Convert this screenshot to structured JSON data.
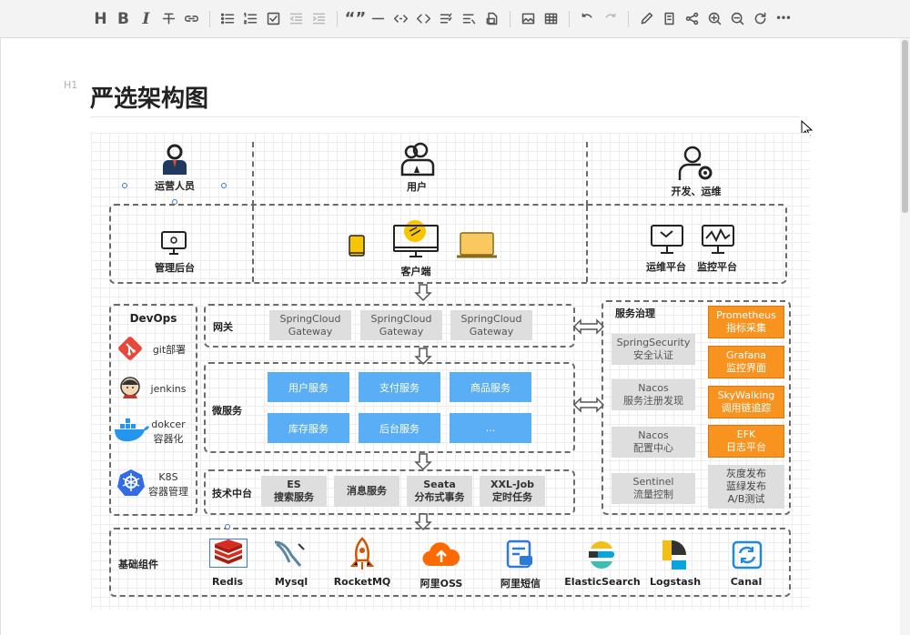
{
  "toolbar": {
    "buttons": [
      "heading",
      "bold",
      "italic",
      "strikethrough",
      "link",
      "bulleted-list",
      "numbered-list",
      "task-list",
      "outdent",
      "indent",
      "quote",
      "horizontal-rule",
      "inline-code",
      "code-block",
      "table-of-contents",
      "outline",
      "export",
      "image",
      "table",
      "undo",
      "redo",
      "edit",
      "notes",
      "share",
      "zoom-in",
      "zoom-out",
      "refresh",
      "more"
    ],
    "heading_glyph": "H",
    "bold_glyph": "B",
    "italic_glyph": "I",
    "quote_glyph": "“”",
    "more_glyph": "•••"
  },
  "document": {
    "heading_tag": "H1",
    "title": "严选架构图"
  },
  "diagram": {
    "actors": {
      "ops": "运营人员",
      "user": "用户",
      "dev": "开发、运维"
    },
    "admin": "管理后台",
    "client": "客户端",
    "ops_platform": "运维平台",
    "monitor_platform": "监控平台",
    "devops": {
      "title": "DevOps",
      "items": [
        {
          "label1": "git部署",
          "label2": ""
        },
        {
          "label1": "jenkins",
          "label2": ""
        },
        {
          "label1": "dokcer",
          "label2": "容器化"
        },
        {
          "label1": "K8S",
          "label2": "容器管理"
        }
      ]
    },
    "gateway": {
      "label": "网关",
      "items": [
        [
          "SpringCloud",
          "Gateway"
        ],
        [
          "SpringCloud",
          "Gateway"
        ],
        [
          "SpringCloud",
          "Gateway"
        ]
      ]
    },
    "microservice": {
      "label": "微服务",
      "items": [
        "用户服务",
        "支付服务",
        "商品服务",
        "库存服务",
        "后台服务",
        "..."
      ]
    },
    "tech": {
      "label": "技术中台",
      "items": [
        [
          "ES",
          "搜索服务"
        ],
        [
          "消息服务",
          ""
        ],
        [
          "Seata",
          "分布式事务"
        ],
        [
          "XXL-Job",
          "定时任务"
        ]
      ]
    },
    "governance": {
      "title": "服务治理",
      "gray": [
        [
          "SpringSecurity",
          "安全认证"
        ],
        [
          "Nacos",
          "服务注册发现"
        ],
        [
          "Nacos",
          "配置中心"
        ],
        [
          "Sentinel",
          "流量控制"
        ]
      ],
      "orange": [
        [
          "Prometheus",
          "指标采集"
        ],
        [
          "Grafana",
          "监控界面"
        ],
        [
          "SkyWalking",
          "调用链追踪"
        ],
        [
          "EFK",
          "日志平台"
        ]
      ],
      "release": [
        "灰度发布",
        "蓝绿发布",
        "A/B测试"
      ]
    },
    "base": {
      "label": "基础组件",
      "items": [
        "Redis",
        "Mysql",
        "RocketMQ",
        "阿里OSS",
        "阿里短信",
        "ElasticSearch",
        "Logstash",
        "Canal"
      ]
    },
    "colors": {
      "blue": "#5aaef5",
      "orange": "#f7931e",
      "gray": "#dedede",
      "dash": "#6b6b6b"
    }
  }
}
